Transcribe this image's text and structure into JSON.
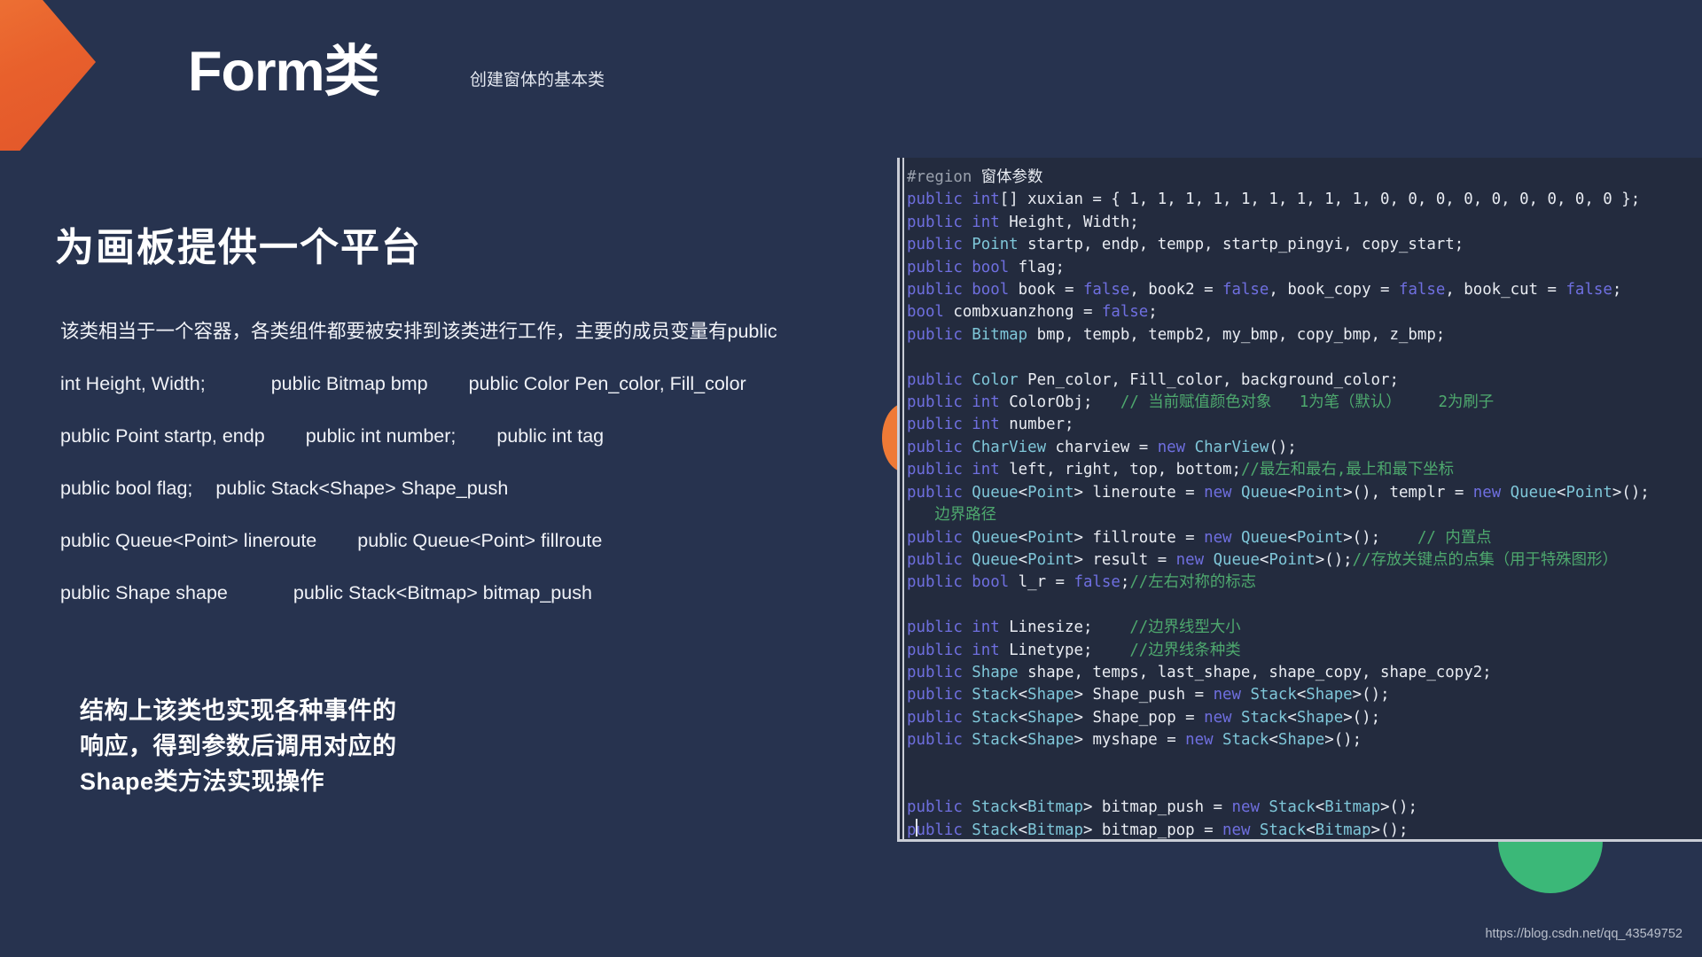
{
  "header": {
    "title": "Form类",
    "subtitle": "创建窗体的基本类"
  },
  "left": {
    "section_heading": "为画板提供一个平台",
    "paragraph": "该类相当于一个容器，各类组件都要被安排到该类进行工作，主要的成员变量有public",
    "line2_a": "int Height, Width;",
    "line2_b": "public Bitmap bmp",
    "line2_c": "public Color Pen_color, Fill_color",
    "line3_a": "public Point startp, endp",
    "line3_b": "public int number;",
    "line3_c": "public int tag",
    "line4_a": "public bool flag;",
    "line4_b": "public Stack<Shape> Shape_push",
    "line5_a": " public Queue<Point> lineroute",
    "line5_b": "public Queue<Point> fillroute",
    "line6_a": "public Shape shape",
    "line6_b": "public Stack<Bitmap> bitmap_push",
    "callout_line1": "结构上该类也实现各种事件的",
    "callout_line2": "响应，得到参数后调用对应的",
    "callout_line3": "Shape类方法实现操作"
  },
  "code_panel": {
    "lines": [
      [
        {
          "t": "#region ",
          "c": "pre"
        },
        {
          "t": "窗体参数",
          "c": "pre-cn"
        }
      ],
      [
        {
          "t": "public ",
          "c": "kw"
        },
        {
          "t": "int",
          "c": "kw"
        },
        {
          "t": "[] xuxian = { ",
          "c": "plain"
        },
        {
          "t": "1",
          "c": "plain"
        },
        {
          "t": ", 1, 1, 1, 1, 1, 1, 1, 1, 0, 0, 0, 0, 0, 0, 0, 0, 0 };",
          "c": "plain"
        }
      ],
      [
        {
          "t": "public ",
          "c": "kw"
        },
        {
          "t": "int",
          "c": "kw"
        },
        {
          "t": " Height, Width;",
          "c": "plain"
        }
      ],
      [
        {
          "t": "public ",
          "c": "kw"
        },
        {
          "t": "Point",
          "c": "typ"
        },
        {
          "t": " startp, endp, tempp, startp_pingyi, copy_start;",
          "c": "plain"
        }
      ],
      [
        {
          "t": "public ",
          "c": "kw"
        },
        {
          "t": "bool",
          "c": "kw"
        },
        {
          "t": " flag;",
          "c": "plain"
        }
      ],
      [
        {
          "t": "public ",
          "c": "kw"
        },
        {
          "t": "bool",
          "c": "kw"
        },
        {
          "t": " book = ",
          "c": "plain"
        },
        {
          "t": "false",
          "c": "lit"
        },
        {
          "t": ", book2 = ",
          "c": "plain"
        },
        {
          "t": "false",
          "c": "lit"
        },
        {
          "t": ", book_copy = ",
          "c": "plain"
        },
        {
          "t": "false",
          "c": "lit"
        },
        {
          "t": ", book_cut = ",
          "c": "plain"
        },
        {
          "t": "false",
          "c": "lit"
        },
        {
          "t": ";",
          "c": "plain"
        }
      ],
      [
        {
          "t": "bool",
          "c": "kw"
        },
        {
          "t": " combxuanzhong = ",
          "c": "plain"
        },
        {
          "t": "false",
          "c": "lit"
        },
        {
          "t": ";",
          "c": "plain"
        }
      ],
      [
        {
          "t": "public ",
          "c": "kw"
        },
        {
          "t": "Bitmap",
          "c": "typ"
        },
        {
          "t": " bmp, tempb, tempb2, my_bmp, copy_bmp, z_bmp;",
          "c": "plain"
        }
      ],
      [],
      [
        {
          "t": "public ",
          "c": "kw"
        },
        {
          "t": "Color",
          "c": "typ"
        },
        {
          "t": " Pen_color, Fill_color, background_color;",
          "c": "plain"
        }
      ],
      [
        {
          "t": "public ",
          "c": "kw"
        },
        {
          "t": "int",
          "c": "kw"
        },
        {
          "t": " ColorObj;   ",
          "c": "plain"
        },
        {
          "t": "// 当前赋值颜色对象   1为笔（默认）    2为刷子",
          "c": "cmt"
        }
      ],
      [
        {
          "t": "public ",
          "c": "kw"
        },
        {
          "t": "int",
          "c": "kw"
        },
        {
          "t": " number;",
          "c": "plain"
        }
      ],
      [
        {
          "t": "public ",
          "c": "kw"
        },
        {
          "t": "CharView",
          "c": "typ"
        },
        {
          "t": " charview = ",
          "c": "plain"
        },
        {
          "t": "new ",
          "c": "kw"
        },
        {
          "t": "CharView",
          "c": "typ"
        },
        {
          "t": "();",
          "c": "plain"
        }
      ],
      [
        {
          "t": "public ",
          "c": "kw"
        },
        {
          "t": "int",
          "c": "kw"
        },
        {
          "t": " left, right, top, bottom;",
          "c": "plain"
        },
        {
          "t": "//最左和最右,最上和最下坐标",
          "c": "cmt"
        }
      ],
      [
        {
          "t": "public ",
          "c": "kw"
        },
        {
          "t": "Queue",
          "c": "typ"
        },
        {
          "t": "<",
          "c": "plain"
        },
        {
          "t": "Point",
          "c": "typ"
        },
        {
          "t": "> lineroute = ",
          "c": "plain"
        },
        {
          "t": "new ",
          "c": "kw"
        },
        {
          "t": "Queue",
          "c": "typ"
        },
        {
          "t": "<",
          "c": "plain"
        },
        {
          "t": "Point",
          "c": "typ"
        },
        {
          "t": ">(), templr = ",
          "c": "plain"
        },
        {
          "t": "new ",
          "c": "kw"
        },
        {
          "t": "Queue",
          "c": "typ"
        },
        {
          "t": "<",
          "c": "plain"
        },
        {
          "t": "Point",
          "c": "typ"
        },
        {
          "t": ">();",
          "c": "plain"
        }
      ],
      [
        {
          "t": "   边界路径",
          "c": "cmt"
        }
      ],
      [
        {
          "t": "public ",
          "c": "kw"
        },
        {
          "t": "Queue",
          "c": "typ"
        },
        {
          "t": "<",
          "c": "plain"
        },
        {
          "t": "Point",
          "c": "typ"
        },
        {
          "t": "> fillroute = ",
          "c": "plain"
        },
        {
          "t": "new ",
          "c": "kw"
        },
        {
          "t": "Queue",
          "c": "typ"
        },
        {
          "t": "<",
          "c": "plain"
        },
        {
          "t": "Point",
          "c": "typ"
        },
        {
          "t": ">();    ",
          "c": "plain"
        },
        {
          "t": "// 内置点",
          "c": "cmt"
        }
      ],
      [
        {
          "t": "public ",
          "c": "kw"
        },
        {
          "t": "Queue",
          "c": "typ"
        },
        {
          "t": "<",
          "c": "plain"
        },
        {
          "t": "Point",
          "c": "typ"
        },
        {
          "t": "> result = ",
          "c": "plain"
        },
        {
          "t": "new ",
          "c": "kw"
        },
        {
          "t": "Queue",
          "c": "typ"
        },
        {
          "t": "<",
          "c": "plain"
        },
        {
          "t": "Point",
          "c": "typ"
        },
        {
          "t": ">();",
          "c": "plain"
        },
        {
          "t": "//存放关键点的点集（用于特殊图形）",
          "c": "cmt"
        }
      ],
      [
        {
          "t": "public ",
          "c": "kw"
        },
        {
          "t": "bool",
          "c": "kw"
        },
        {
          "t": " l_r = ",
          "c": "plain"
        },
        {
          "t": "false",
          "c": "lit"
        },
        {
          "t": ";",
          "c": "plain"
        },
        {
          "t": "//左右对称的标志",
          "c": "cmt"
        }
      ],
      [],
      [
        {
          "t": "public ",
          "c": "kw"
        },
        {
          "t": "int",
          "c": "kw"
        },
        {
          "t": " Linesize;    ",
          "c": "plain"
        },
        {
          "t": "//边界线型大小",
          "c": "cmt"
        }
      ],
      [
        {
          "t": "public ",
          "c": "kw"
        },
        {
          "t": "int",
          "c": "kw"
        },
        {
          "t": " Linetype;    ",
          "c": "plain"
        },
        {
          "t": "//边界线条种类",
          "c": "cmt"
        }
      ],
      [
        {
          "t": "public ",
          "c": "kw"
        },
        {
          "t": "Shape",
          "c": "typ"
        },
        {
          "t": " shape, temps, last_shape, shape_copy, shape_copy2;",
          "c": "plain"
        }
      ],
      [
        {
          "t": "public ",
          "c": "kw"
        },
        {
          "t": "Stack",
          "c": "typ"
        },
        {
          "t": "<",
          "c": "plain"
        },
        {
          "t": "Shape",
          "c": "typ"
        },
        {
          "t": "> Shape_push = ",
          "c": "plain"
        },
        {
          "t": "new ",
          "c": "kw"
        },
        {
          "t": "Stack",
          "c": "typ"
        },
        {
          "t": "<",
          "c": "plain"
        },
        {
          "t": "Shape",
          "c": "typ"
        },
        {
          "t": ">();",
          "c": "plain"
        }
      ],
      [
        {
          "t": "public ",
          "c": "kw"
        },
        {
          "t": "Stack",
          "c": "typ"
        },
        {
          "t": "<",
          "c": "plain"
        },
        {
          "t": "Shape",
          "c": "typ"
        },
        {
          "t": "> Shape_pop = ",
          "c": "plain"
        },
        {
          "t": "new ",
          "c": "kw"
        },
        {
          "t": "Stack",
          "c": "typ"
        },
        {
          "t": "<",
          "c": "plain"
        },
        {
          "t": "Shape",
          "c": "typ"
        },
        {
          "t": ">();",
          "c": "plain"
        }
      ],
      [
        {
          "t": "public ",
          "c": "kw"
        },
        {
          "t": "Stack",
          "c": "typ"
        },
        {
          "t": "<",
          "c": "plain"
        },
        {
          "t": "Shape",
          "c": "typ"
        },
        {
          "t": "> myshape = ",
          "c": "plain"
        },
        {
          "t": "new ",
          "c": "kw"
        },
        {
          "t": "Stack",
          "c": "typ"
        },
        {
          "t": "<",
          "c": "plain"
        },
        {
          "t": "Shape",
          "c": "typ"
        },
        {
          "t": ">();",
          "c": "plain"
        }
      ],
      [],
      [],
      [
        {
          "t": "public ",
          "c": "kw"
        },
        {
          "t": "Stack",
          "c": "typ"
        },
        {
          "t": "<",
          "c": "plain"
        },
        {
          "t": "Bitmap",
          "c": "typ"
        },
        {
          "t": "> bitmap_push = ",
          "c": "plain"
        },
        {
          "t": "new ",
          "c": "kw"
        },
        {
          "t": "Stack",
          "c": "typ"
        },
        {
          "t": "<",
          "c": "plain"
        },
        {
          "t": "Bitmap",
          "c": "typ"
        },
        {
          "t": ">();",
          "c": "plain"
        }
      ],
      [
        {
          "t": "public ",
          "c": "kw"
        },
        {
          "t": "Stack",
          "c": "typ"
        },
        {
          "t": "<",
          "c": "plain"
        },
        {
          "t": "Bitmap",
          "c": "typ"
        },
        {
          "t": "> bitmap_pop = ",
          "c": "plain"
        },
        {
          "t": "new ",
          "c": "kw"
        },
        {
          "t": "Stack",
          "c": "typ"
        },
        {
          "t": "<",
          "c": "plain"
        },
        {
          "t": "Bitmap",
          "c": "typ"
        },
        {
          "t": ">();",
          "c": "plain"
        }
      ]
    ]
  },
  "footer": {
    "watermark": "https://blog.csdn.net/qq_43549752"
  },
  "colors": {
    "background": "#27334f",
    "accent_orange": "#ef7a36",
    "accent_green": "#3bb878",
    "code_background": "#232b3e",
    "keyword": "#6f6fe0",
    "type": "#7fc7d9",
    "comment": "#4ea96e"
  }
}
